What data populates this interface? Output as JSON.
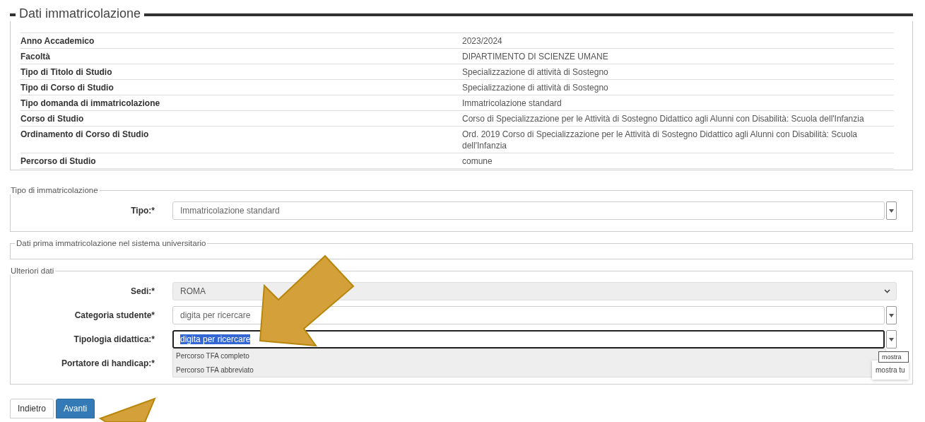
{
  "section_title": "Dati immatricolazione",
  "details": [
    {
      "label": "Anno Accademico",
      "value": "2023/2024"
    },
    {
      "label": "Facoltà",
      "value": "DIPARTIMENTO DI SCIENZE UMANE"
    },
    {
      "label": "Tipo di Titolo di Studio",
      "value": "Specializzazione di attività di Sostegno"
    },
    {
      "label": "Tipo di Corso di Studio",
      "value": "Specializzazione di attività di Sostegno"
    },
    {
      "label": "Tipo domanda di immatricolazione",
      "value": "Immatricolazione standard"
    },
    {
      "label": "Corso di Studio",
      "value": "Corso di Specializzazione per le Attività di Sostegno Didattico agli Alunni con Disabilità: Scuola dell'Infanzia"
    },
    {
      "label": "Ordinamento di Corso di Studio",
      "value": "Ord. 2019 Corso di Specializzazione per le Attività di Sostegno Didattico agli Alunni con Disabilità: Scuola dell'Infanzia"
    },
    {
      "label": "Percorso di Studio",
      "value": "comune"
    }
  ],
  "fieldsets": [
    {
      "legend": "Tipo di immatricolazione",
      "fields": [
        {
          "kind": "combo",
          "label": "Tipo:*",
          "value": "Immatricolazione standard",
          "focused": false
        }
      ]
    },
    {
      "legend": "Dati prima immatricolazione nel sistema universitario"
    },
    {
      "legend": "Ulteriori dati",
      "fields": [
        {
          "kind": "select",
          "label": "Sedi:*",
          "value": "ROMA"
        },
        {
          "kind": "combo",
          "label": "Categoria studente*",
          "value": "digita per ricercare",
          "focused": false
        },
        {
          "kind": "combo",
          "label": "Tipologia didattica:*",
          "value": "digita per ricercare",
          "focused": true,
          "options": [
            "Percorso TFA completo",
            "Percorso TFA abbreviato"
          ],
          "tooltips": [
            "mostra",
            "mostra tu"
          ]
        },
        {
          "kind": "covered",
          "label": "Portatore di handicap:*"
        }
      ]
    }
  ],
  "buttons": [
    {
      "label": "Indietro",
      "primary": false
    },
    {
      "label": "Avanti",
      "primary": true
    }
  ]
}
